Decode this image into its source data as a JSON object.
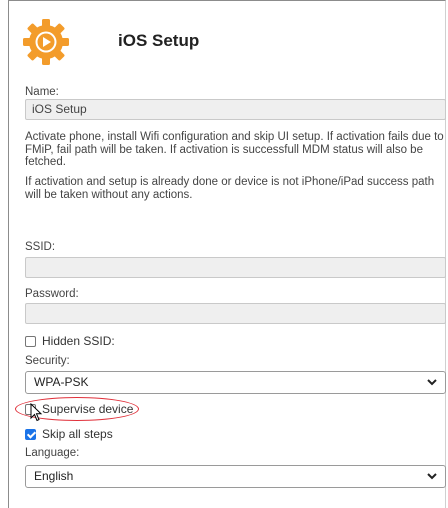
{
  "header": {
    "title": "iOS Setup",
    "logo_icon": "orange-gear-play-icon",
    "logo_color": "#f39c2b"
  },
  "form": {
    "name_label": "Name:",
    "name_value": "iOS Setup",
    "description_1": "Activate phone, install Wifi configuration and skip UI setup. If activation fails due to FMiP, fail path will be taken. If activation is successfull MDM status will also be fetched.",
    "description_2": "If activation and setup is already done or device is not iPhone/iPad success path will be taken without any actions.",
    "ssid_label": "SSID:",
    "ssid_value": "",
    "password_label": "Password:",
    "password_value": "",
    "hidden_ssid_label": "Hidden SSID:",
    "hidden_ssid_checked": false,
    "security_label": "Security:",
    "security_value": "WPA-PSK",
    "supervise_label": "Supervise device",
    "supervise_checked": false,
    "skip_label": "Skip all steps",
    "skip_checked": true,
    "language_label": "Language:",
    "language_value": "English"
  },
  "annotation": {
    "highlight_color": "#e0303a"
  }
}
